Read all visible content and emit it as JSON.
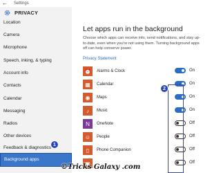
{
  "window": {
    "title": "Settings"
  },
  "sidebar": {
    "header": "PRIVACY",
    "items": [
      {
        "label": "Location"
      },
      {
        "label": "Camera"
      },
      {
        "label": "Microphone"
      },
      {
        "label": "Speech, inking, & typing"
      },
      {
        "label": "Account info"
      },
      {
        "label": "Contacts"
      },
      {
        "label": "Calendar"
      },
      {
        "label": "Messaging"
      },
      {
        "label": "Radios"
      },
      {
        "label": "Other devices"
      },
      {
        "label": "Feedback & diagnostics"
      },
      {
        "label": "Background apps",
        "selected": true
      }
    ]
  },
  "main": {
    "title": "Let apps run in the background",
    "description": "Choose which apps can receive info, send notifications, and stay up-to-date, even when you're not using them. Turning background apps off can help conserve power.",
    "privacy_link": "Privacy Statement",
    "apps": [
      {
        "name": "Alarms & Clock",
        "icon": "alarm-clock-icon",
        "color": "#d35b2e",
        "state": "On",
        "on": true
      },
      {
        "name": "Calendar",
        "icon": "calendar-icon",
        "color": "#d35b2e",
        "state": "On",
        "on": true
      },
      {
        "name": "Maps",
        "icon": "maps-icon",
        "color": "#d35b2e",
        "state": "On",
        "on": true
      },
      {
        "name": "Music",
        "icon": "music-icon",
        "color": "#d35b2e",
        "state": "On",
        "on": true
      },
      {
        "name": "OneNote",
        "icon": "onenote-icon",
        "color": "#7a3a96",
        "state": "Off",
        "on": false
      },
      {
        "name": "People",
        "icon": "people-icon",
        "color": "#d35b2e",
        "state": "Off",
        "on": false
      },
      {
        "name": "Phone Companion",
        "icon": "phone-companion-icon",
        "color": "#d35b2e",
        "state": "Off",
        "on": false
      },
      {
        "name": "",
        "icon": "app-icon",
        "color": "#d35b2e",
        "state": "Off",
        "on": false
      }
    ]
  },
  "annotations": {
    "badge1": "1",
    "badge2": "2"
  },
  "watermark": "©Tricks Galaxy .com",
  "colors": {
    "accent": "#2b6dc4",
    "selected_nav": "#3a76c9",
    "app_tile": "#d35b2e",
    "onenote_tile": "#7a3a96"
  }
}
